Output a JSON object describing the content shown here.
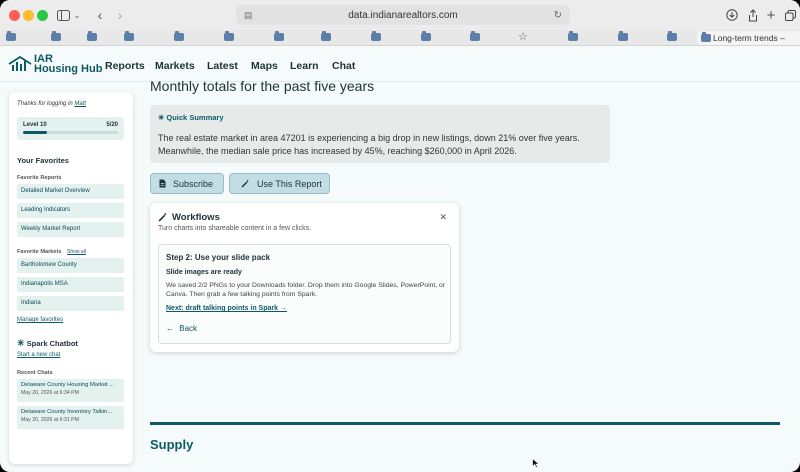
{
  "browser": {
    "url": "data.indianarealtors.com",
    "active_tab_title": "Long-term trends –",
    "favorites_count": 12
  },
  "site": {
    "logo_line1": "IAR",
    "logo_line2": "Housing Hub",
    "nav": [
      "Reports",
      "Markets",
      "Latest",
      "Maps",
      "Learn",
      "Chat"
    ]
  },
  "sidebar": {
    "greeting_prefix": "Thanks for logging in",
    "user": "Matt",
    "level_label": "Level 10",
    "level_progress": "5/20",
    "level_fraction": 0.25,
    "favorites_heading": "Your Favorites",
    "favorite_reports_heading": "Favorite Reports",
    "favorite_reports": [
      "Detailed Market Overview",
      "Leading Indicators",
      "Weekly Market Report"
    ],
    "favorite_markets_heading": "Favorite Markets",
    "show_all": "Show all",
    "favorite_markets": [
      "Bartholomew County",
      "Indianapolis MSA",
      "Indiana"
    ],
    "manage_favorites": "Manage favorites",
    "chatbot_heading": "Spark Chatbot",
    "new_chat": "Start a new chat",
    "recent_chats_heading": "Recent Chats",
    "recent_chats": [
      {
        "title": "Delaware County Housing Market ...",
        "date": "May 20, 2026 at 6:34 PM"
      },
      {
        "title": "Delaware County Inventory Talkin...",
        "date": "May 20, 2026 at 6:31 PM"
      }
    ]
  },
  "main": {
    "title": "Monthly totals for the past five years",
    "summary_heading": "Quick Summary",
    "summary_text": "The real estate market in area 47201 is experiencing a big drop in new listings, down 21% over five years. Meanwhile, the median sale price has increased by 45%, reaching $260,000 in April 2026.",
    "subscribe_label": "Subscribe",
    "use_report_label": "Use This Report",
    "section_heading": "Supply"
  },
  "workflows": {
    "title": "Workflows",
    "subtitle": "Turn charts into shareable content in a few clicks.",
    "step_title": "Step 2: Use your slide pack",
    "step_heading": "Slide images are ready",
    "step_text": "We saved 2/2 PNGs to your Downloads folder. Drop them into Google Slides, PowerPoint, or Canva. Then grab a few talking points from Spark.",
    "next_link": "Next: draft talking points in Spark →",
    "back_label": "Back"
  },
  "colors": {
    "brand": "#0d5a66",
    "page_bg": "#f4fbfa",
    "button_bg": "#c3dde4"
  }
}
